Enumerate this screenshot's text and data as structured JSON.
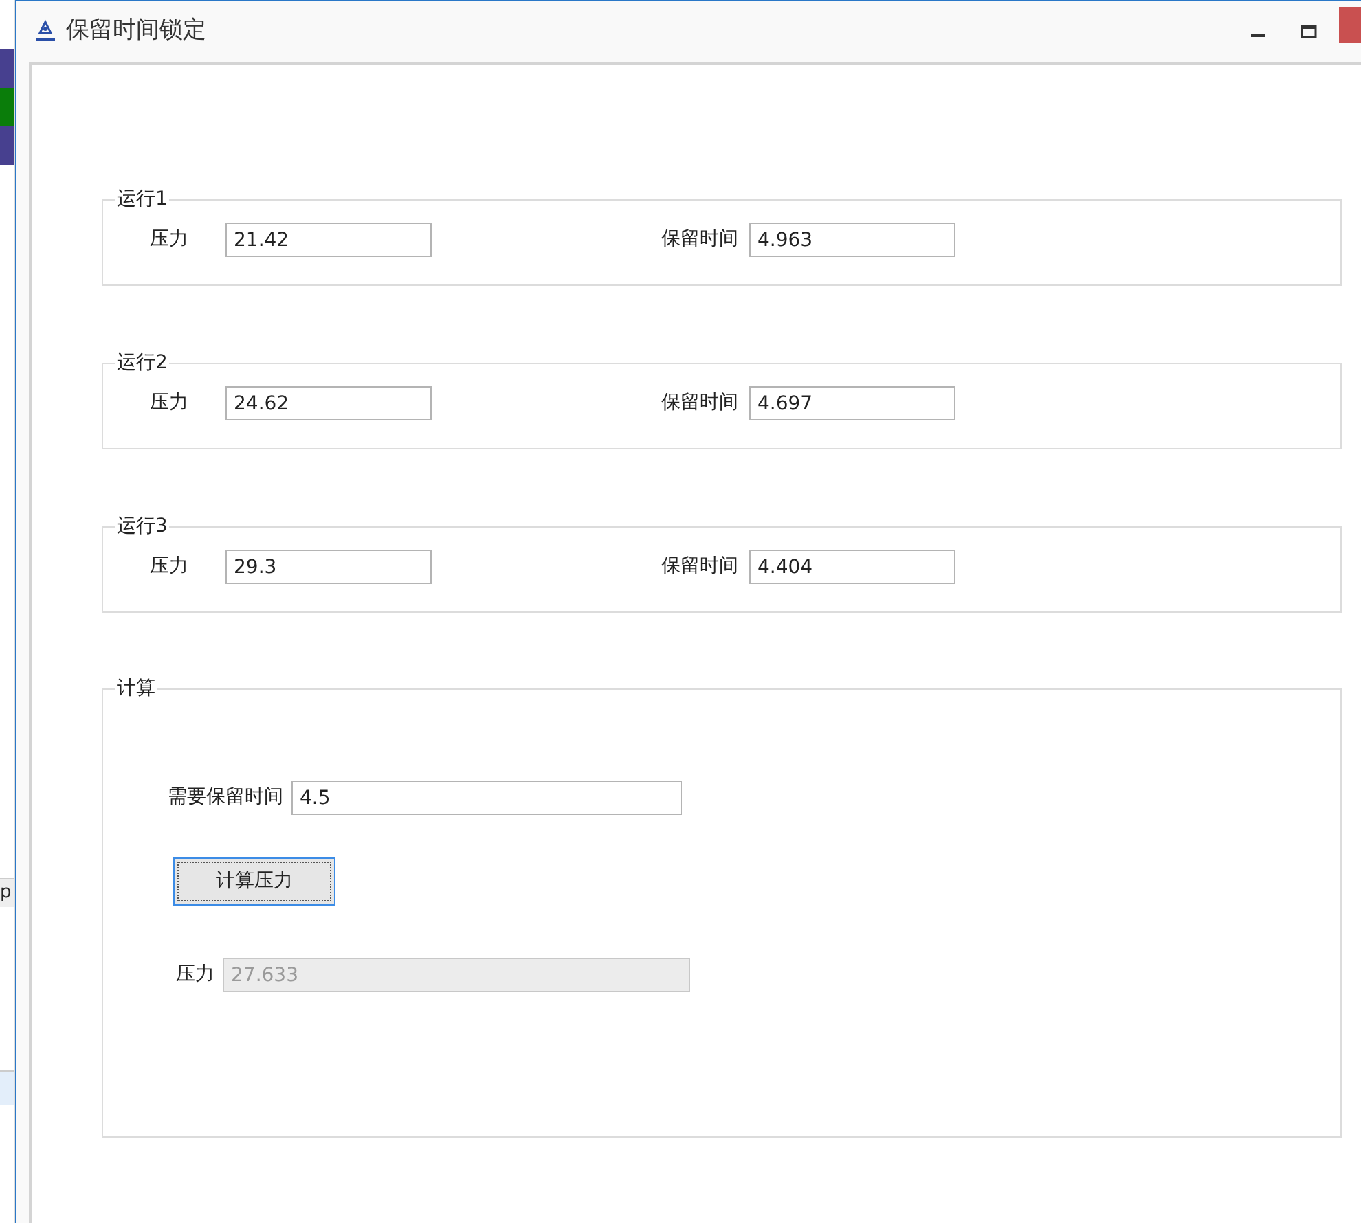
{
  "window": {
    "title": "保留时间锁定"
  },
  "runs": [
    {
      "title": "运行1",
      "pressure_label": "压力",
      "pressure": "21.42",
      "time_label": "保留时间",
      "time": "4.963"
    },
    {
      "title": "运行2",
      "pressure_label": "压力",
      "pressure": "24.62",
      "time_label": "保留时间",
      "time": "4.697"
    },
    {
      "title": "运行3",
      "pressure_label": "压力",
      "pressure": "29.3",
      "time_label": "保留时间",
      "time": "4.404"
    }
  ],
  "calc": {
    "title": "计算",
    "required_label": "需要保留时间",
    "required": "4.5",
    "button": {
      "label": "计算压力",
      "focused": true
    },
    "result_label": "压力",
    "result": {
      "value": "27.633",
      "disabled": true
    }
  },
  "background": {
    "texts": [
      "p"
    ]
  }
}
